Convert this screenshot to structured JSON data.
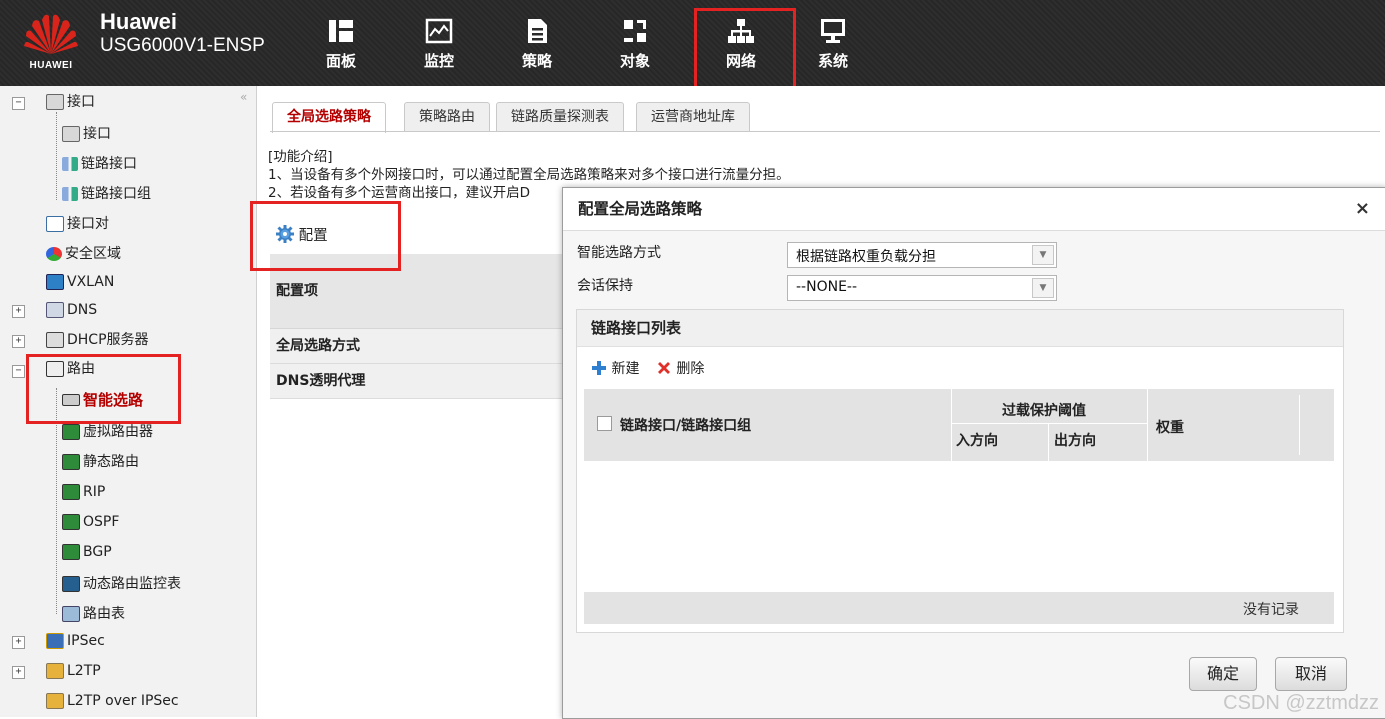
{
  "header": {
    "logo_text": "HUAWEI",
    "brand_name": "Huawei",
    "model": "USG6000V1-ENSP",
    "nav": [
      {
        "label": "面板",
        "icon": "dashboard-icon"
      },
      {
        "label": "监控",
        "icon": "monitor-icon"
      },
      {
        "label": "策略",
        "icon": "policy-icon"
      },
      {
        "label": "对象",
        "icon": "object-icon"
      },
      {
        "label": "网络",
        "icon": "network-icon",
        "active": true
      },
      {
        "label": "系统",
        "icon": "system-icon"
      }
    ]
  },
  "sidebar": {
    "collapse": "«",
    "items": [
      {
        "label": "接口",
        "icon": "interface-group-icon",
        "toggle": "−"
      },
      {
        "label": "接口",
        "icon": "interface-icon"
      },
      {
        "label": "链路接口",
        "icon": "link-interface-icon"
      },
      {
        "label": "链路接口组",
        "icon": "link-group-icon"
      },
      {
        "label": "接口对",
        "icon": "interface-pair-icon"
      },
      {
        "label": "安全区域",
        "icon": "security-zone-icon"
      },
      {
        "label": "VXLAN",
        "icon": "vxlan-icon"
      },
      {
        "label": "DNS",
        "icon": "dns-icon",
        "toggle": "+"
      },
      {
        "label": "DHCP服务器",
        "icon": "dhcp-icon",
        "toggle": "+"
      },
      {
        "label": "路由",
        "icon": "router-icon",
        "toggle": "−"
      },
      {
        "label": "智能选路",
        "icon": "smart-route-icon",
        "selected": true
      },
      {
        "label": "虚拟路由器",
        "icon": "virtual-router-icon"
      },
      {
        "label": "静态路由",
        "icon": "static-route-icon"
      },
      {
        "label": "RIP",
        "icon": "rip-icon"
      },
      {
        "label": "OSPF",
        "icon": "ospf-icon"
      },
      {
        "label": "BGP",
        "icon": "bgp-icon"
      },
      {
        "label": "动态路由监控表",
        "icon": "route-monitor-icon"
      },
      {
        "label": "路由表",
        "icon": "route-table-icon"
      },
      {
        "label": "IPSec",
        "icon": "ipsec-icon",
        "toggle": "+"
      },
      {
        "label": "L2TP",
        "icon": "l2tp-icon",
        "toggle": "+"
      },
      {
        "label": "L2TP over IPSec",
        "icon": "l2tp-ipsec-icon"
      }
    ]
  },
  "tabs": [
    "全局选路策略",
    "策略路由",
    "链路质量探测表",
    "运营商地址库"
  ],
  "intro": {
    "title": "[功能介绍]",
    "line1": "1、当设备有多个外网接口时，可以通过配置全局选路策略来对多个接口进行流量分担。",
    "line2": "2、若设备有多个运营商出接口，建议开启D"
  },
  "config": {
    "button": "配置",
    "header": "配置项",
    "rows": [
      "全局选路方式",
      "DNS透明代理"
    ]
  },
  "dialog": {
    "title": "配置全局选路策略",
    "close": "×",
    "mode_label": "智能选路方式",
    "mode_value": "根据链路权重负载分担",
    "session_label": "会话保持",
    "session_value": "--NONE--",
    "panel_title": "链路接口列表",
    "new": "新建",
    "delete": "删除",
    "columns": {
      "interface": "链路接口/链路接口组",
      "overload": "过载保护阈值",
      "inbound": "入方向",
      "outbound": "出方向",
      "weight": "权重"
    },
    "no_records": "没有记录",
    "ok": "确定",
    "cancel": "取消"
  },
  "watermark": "CSDN @zztmdzz",
  "colors": {
    "accent": "#b50000",
    "highlight": "#e52222",
    "header_bg": "#2b2b2b"
  }
}
